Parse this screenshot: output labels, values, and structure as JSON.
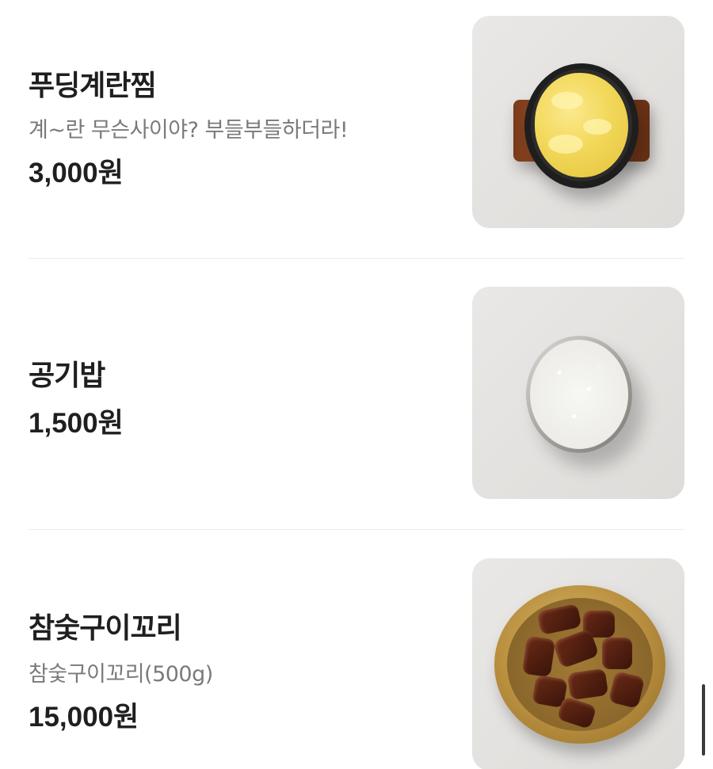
{
  "menu": {
    "items": [
      {
        "name": "푸딩계란찜",
        "description": "계~란 무슨사이야? 부들부들하더라!",
        "price": "3,000원",
        "image": "steamed-egg-photo"
      },
      {
        "name": "공기밥",
        "description": "",
        "price": "1,500원",
        "image": "rice-bowl-photo"
      },
      {
        "name": "참숯구이꼬리",
        "description": "참숯구이꼬리(500g)",
        "price": "15,000원",
        "image": "grilled-oxtail-photo"
      }
    ]
  },
  "colors": {
    "background": "#ffffff",
    "text_primary": "#1f1f1f",
    "text_secondary": "#7a7a7a",
    "divider": "#ececec",
    "thumb_background": "#e6e5e2"
  }
}
